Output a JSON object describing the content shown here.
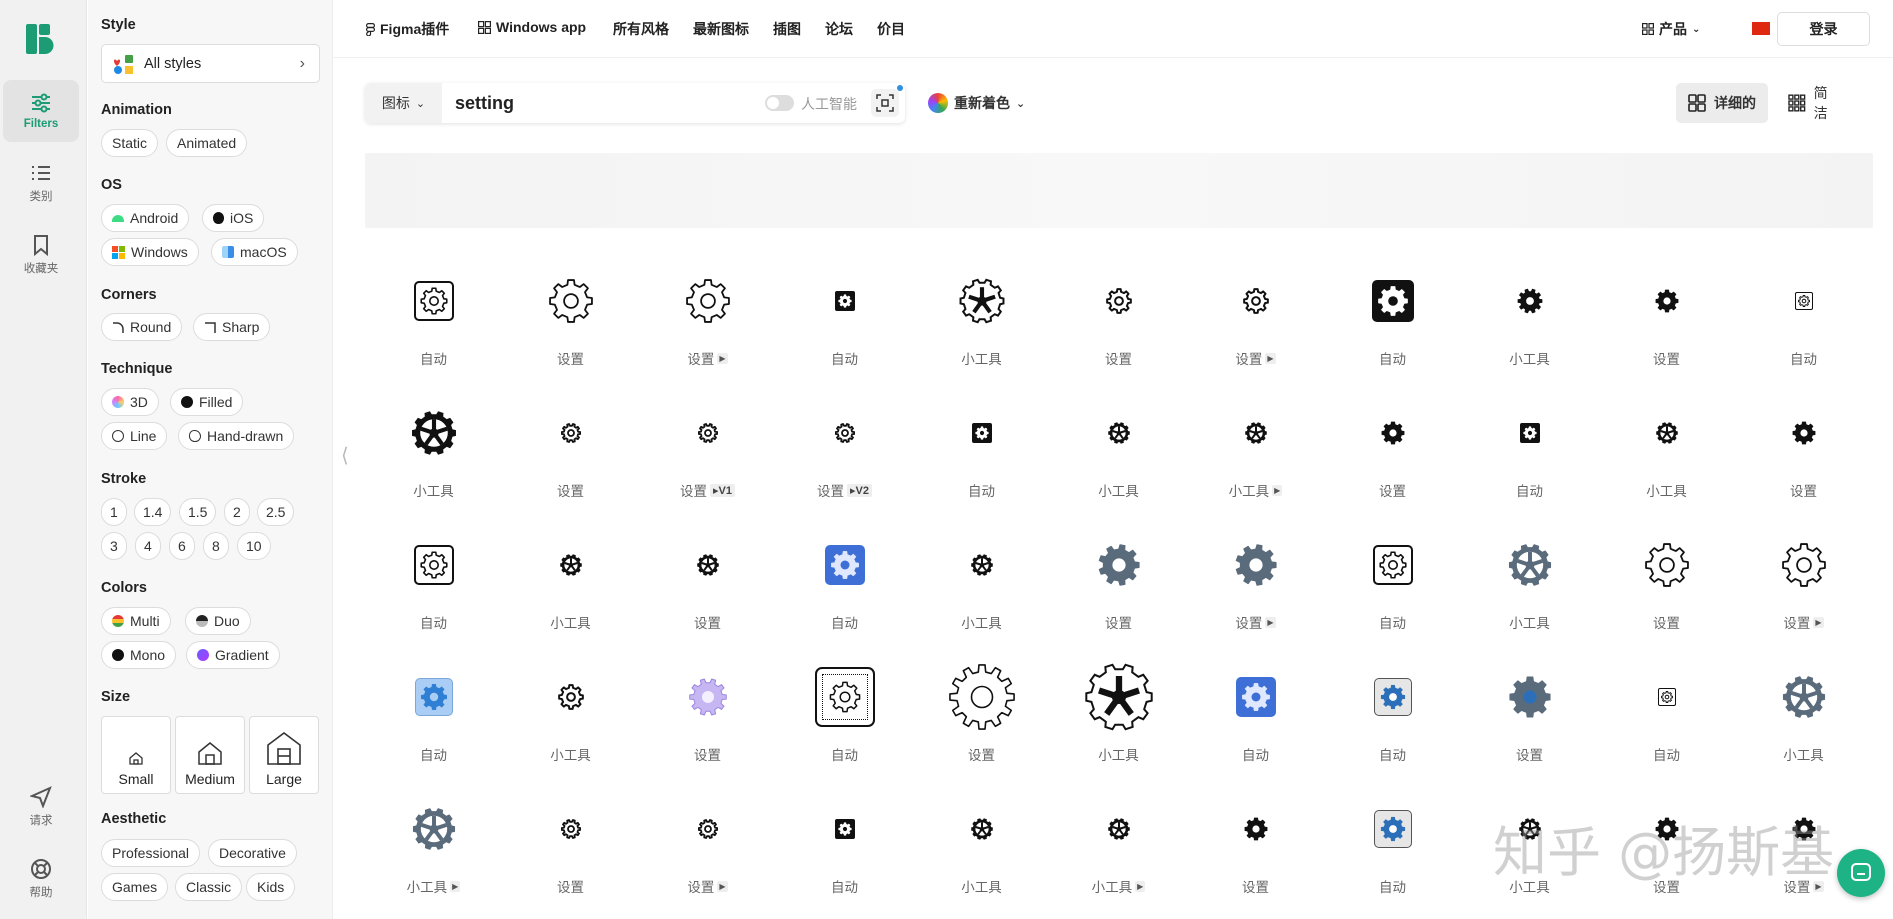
{
  "rail": {
    "items": [
      {
        "label": "Filters",
        "icon": "sliders-icon"
      },
      {
        "label": "类别",
        "icon": "list-icon"
      },
      {
        "label": "收藏夹",
        "icon": "bookmark-icon"
      },
      {
        "label": "请求",
        "icon": "send-icon"
      },
      {
        "label": "帮助",
        "icon": "lifebuoy-icon"
      }
    ]
  },
  "filters": {
    "style_title": "Style",
    "style_value": "All styles",
    "animation_title": "Animation",
    "animation": [
      "Static",
      "Animated"
    ],
    "os_title": "OS",
    "os": [
      "Android",
      "iOS",
      "Windows",
      "macOS"
    ],
    "corners_title": "Corners",
    "corners": [
      "Round",
      "Sharp"
    ],
    "technique_title": "Technique",
    "technique": [
      "3D",
      "Filled",
      "Line",
      "Hand-drawn"
    ],
    "stroke_title": "Stroke",
    "stroke": [
      "1",
      "1.4",
      "1.5",
      "2",
      "2.5",
      "3",
      "4",
      "6",
      "8",
      "10"
    ],
    "colors_title": "Colors",
    "colors": [
      "Multi",
      "Duo",
      "Mono",
      "Gradient"
    ],
    "size_title": "Size",
    "size": [
      "Small",
      "Medium",
      "Large"
    ],
    "aesthetic_title": "Aesthetic",
    "aesthetic": [
      "Professional",
      "Decorative",
      "Games",
      "Classic",
      "Kids"
    ]
  },
  "nav": {
    "items": [
      "Figma插件",
      "Windows app",
      "所有风格",
      "最新图标",
      "插图",
      "论坛",
      "价目"
    ],
    "products": "产品",
    "login": "登录"
  },
  "search": {
    "type": "图标",
    "query": "setting",
    "ai_label": "人工智能",
    "recolor": "重新着色"
  },
  "view": {
    "detailed": "详细的",
    "simple": "简洁"
  },
  "grid": {
    "rows": [
      [
        {
          "label": "自动",
          "icon": "gear-square-outline-icon"
        },
        {
          "label": "设置",
          "icon": "gear-outline-icon"
        },
        {
          "label": "设置",
          "icon": "gear-outline-icon",
          "animated": true
        },
        {
          "label": "自动",
          "icon": "gear-square-filled-icon"
        },
        {
          "label": "小工具",
          "icon": "wheel-spokes-icon"
        },
        {
          "label": "设置",
          "icon": "gear-thin-icon"
        },
        {
          "label": "设置",
          "icon": "gear-thin-icon",
          "animated": true
        },
        {
          "label": "自动",
          "icon": "gear-square-black-icon"
        },
        {
          "label": "小工具",
          "icon": "gear-bold-icon"
        },
        {
          "label": "设置",
          "icon": "gear-filled-icon"
        },
        {
          "label": "自动",
          "icon": "gear-square-small-icon"
        }
      ],
      [
        {
          "label": "小工具",
          "icon": "wheel-filled-icon"
        },
        {
          "label": "设置",
          "icon": "gear-small-icon"
        },
        {
          "label": "设置",
          "icon": "gear-small-icon",
          "version": "V1"
        },
        {
          "label": "设置",
          "icon": "gear-small-icon",
          "version": "V2"
        },
        {
          "label": "自动",
          "icon": "gear-square-filled-icon"
        },
        {
          "label": "小工具",
          "icon": "wheel-small-icon"
        },
        {
          "label": "小工具",
          "icon": "wheel-small-icon",
          "animated": true
        },
        {
          "label": "设置",
          "icon": "gear-filled-icon"
        },
        {
          "label": "自动",
          "icon": "gear-square-filled-icon"
        },
        {
          "label": "小工具",
          "icon": "wheel-small-icon"
        },
        {
          "label": "设置",
          "icon": "gear-filled-icon"
        }
      ],
      [
        {
          "label": "自动",
          "icon": "gear-square-outline-icon"
        },
        {
          "label": "小工具",
          "icon": "wheel-small-icon"
        },
        {
          "label": "设置",
          "icon": "wheel-small-icon"
        },
        {
          "label": "自动",
          "icon": "gear-square-blue-icon"
        },
        {
          "label": "小工具",
          "icon": "wheel-small-icon"
        },
        {
          "label": "设置",
          "icon": "gear-slate-icon"
        },
        {
          "label": "设置",
          "icon": "gear-slate-icon",
          "animated": true
        },
        {
          "label": "自动",
          "icon": "gear-square-outline-icon"
        },
        {
          "label": "小工具",
          "icon": "wheel-slate-icon"
        },
        {
          "label": "设置",
          "icon": "gear-outline-icon"
        },
        {
          "label": "设置",
          "icon": "gear-outline-icon",
          "animated": true
        }
      ],
      [
        {
          "label": "自动",
          "icon": "gear-square-lightblue-icon"
        },
        {
          "label": "小工具",
          "icon": "gear-thin-icon"
        },
        {
          "label": "设置",
          "icon": "gear-lavender-icon"
        },
        {
          "label": "自动",
          "icon": "gear-square-dotted-icon"
        },
        {
          "label": "设置",
          "icon": "gear-large-outline-icon"
        },
        {
          "label": "小工具",
          "icon": "wheel-large-outline-icon"
        },
        {
          "label": "自动",
          "icon": "gear-square-blue-icon"
        },
        {
          "label": "自动",
          "icon": "gear-square-grey-icon"
        },
        {
          "label": "设置",
          "icon": "gear-slate-blue-icon"
        },
        {
          "label": "自动",
          "icon": "gear-square-small-icon"
        },
        {
          "label": "小工具",
          "icon": "wheel-slate-icon"
        }
      ],
      [
        {
          "label": "小工具",
          "icon": "wheel-slate-icon",
          "animated": true
        },
        {
          "label": "设置",
          "icon": "gear-small-icon"
        },
        {
          "label": "设置",
          "icon": "gear-small-icon",
          "animated": true
        },
        {
          "label": "自动",
          "icon": "gear-square-filled-icon"
        },
        {
          "label": "小工具",
          "icon": "wheel-small-icon"
        },
        {
          "label": "小工具",
          "icon": "wheel-small-icon",
          "animated": true
        },
        {
          "label": "设置",
          "icon": "gear-filled-icon"
        },
        {
          "label": "自动",
          "icon": "gear-square-grey-icon"
        },
        {
          "label": "小工具",
          "icon": "wheel-small-icon"
        },
        {
          "label": "设置",
          "icon": "gear-filled-icon"
        },
        {
          "label": "设置",
          "icon": "gear-filled-icon",
          "animated": true
        }
      ]
    ]
  },
  "watermark": "知乎 @扬斯基",
  "colors": {
    "brand": "#1c9c74",
    "accent_blue": "#3d6fd6",
    "slate": "#5a6b7c"
  }
}
